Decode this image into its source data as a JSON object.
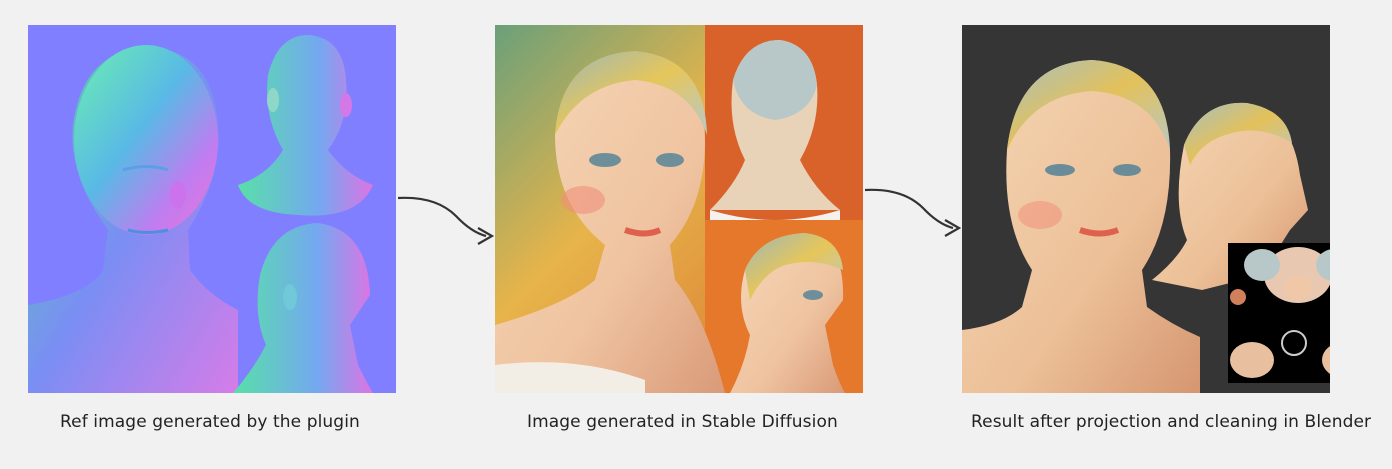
{
  "captions": {
    "ref": "Ref image generated by the plugin",
    "sd": "Image generated in Stable Diffusion",
    "result": "Result after projection and cleaning in Blender"
  },
  "colors": {
    "background": "#f1f1f1",
    "normal_map_bg": "#7f7fff",
    "result_bg": "#353535",
    "arrow": "#333333"
  }
}
